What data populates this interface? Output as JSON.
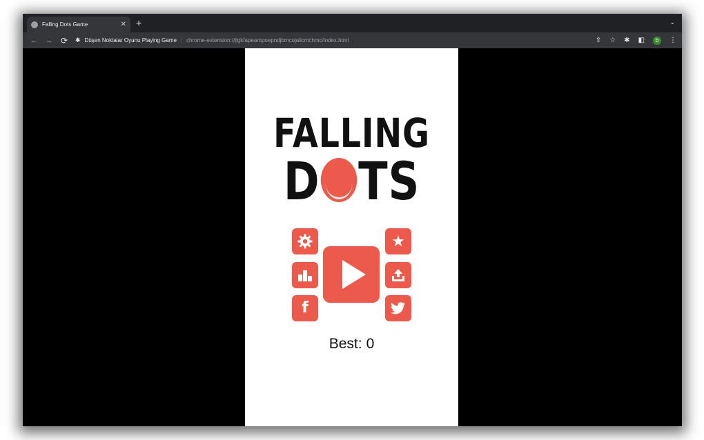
{
  "browser": {
    "tab_title": "Falling Dots Game",
    "tab_close": "✕",
    "new_tab": "+",
    "tab_menu": "⌄",
    "site_name": "Düşen Noktalar Oyunu Playing Game",
    "separator": "|",
    "url": "chrome-extension://jlgkfapeampoepndjbmcojalicmchmc/index.html",
    "avatar_letter": "b"
  },
  "game": {
    "title_line1": "FALLING",
    "title_line2_left": "D",
    "title_line2_right": "TS",
    "best_label": "Best:",
    "best_value": "0",
    "accent_color": "#ec5a4b",
    "buttons": {
      "left": [
        "gear-icon",
        "podium-icon",
        "facebook-icon"
      ],
      "right": [
        "star-icon",
        "share-icon",
        "twitter-icon"
      ],
      "center": "play-icon"
    }
  }
}
